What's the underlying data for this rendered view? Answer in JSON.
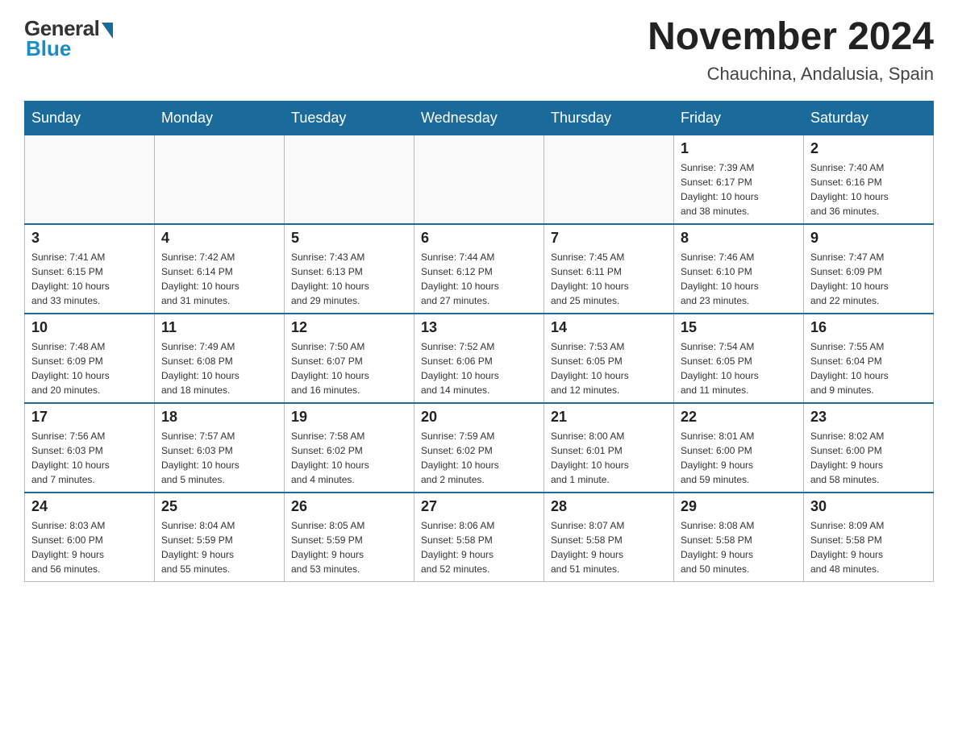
{
  "logo": {
    "general": "General",
    "blue": "Blue"
  },
  "header": {
    "month_year": "November 2024",
    "location": "Chauchina, Andalusia, Spain"
  },
  "days_of_week": [
    "Sunday",
    "Monday",
    "Tuesday",
    "Wednesday",
    "Thursday",
    "Friday",
    "Saturday"
  ],
  "weeks": [
    [
      {
        "day": "",
        "info": "",
        "empty": true
      },
      {
        "day": "",
        "info": "",
        "empty": true
      },
      {
        "day": "",
        "info": "",
        "empty": true
      },
      {
        "day": "",
        "info": "",
        "empty": true
      },
      {
        "day": "",
        "info": "",
        "empty": true
      },
      {
        "day": "1",
        "info": "Sunrise: 7:39 AM\nSunset: 6:17 PM\nDaylight: 10 hours\nand 38 minutes."
      },
      {
        "day": "2",
        "info": "Sunrise: 7:40 AM\nSunset: 6:16 PM\nDaylight: 10 hours\nand 36 minutes."
      }
    ],
    [
      {
        "day": "3",
        "info": "Sunrise: 7:41 AM\nSunset: 6:15 PM\nDaylight: 10 hours\nand 33 minutes."
      },
      {
        "day": "4",
        "info": "Sunrise: 7:42 AM\nSunset: 6:14 PM\nDaylight: 10 hours\nand 31 minutes."
      },
      {
        "day": "5",
        "info": "Sunrise: 7:43 AM\nSunset: 6:13 PM\nDaylight: 10 hours\nand 29 minutes."
      },
      {
        "day": "6",
        "info": "Sunrise: 7:44 AM\nSunset: 6:12 PM\nDaylight: 10 hours\nand 27 minutes."
      },
      {
        "day": "7",
        "info": "Sunrise: 7:45 AM\nSunset: 6:11 PM\nDaylight: 10 hours\nand 25 minutes."
      },
      {
        "day": "8",
        "info": "Sunrise: 7:46 AM\nSunset: 6:10 PM\nDaylight: 10 hours\nand 23 minutes."
      },
      {
        "day": "9",
        "info": "Sunrise: 7:47 AM\nSunset: 6:09 PM\nDaylight: 10 hours\nand 22 minutes."
      }
    ],
    [
      {
        "day": "10",
        "info": "Sunrise: 7:48 AM\nSunset: 6:09 PM\nDaylight: 10 hours\nand 20 minutes."
      },
      {
        "day": "11",
        "info": "Sunrise: 7:49 AM\nSunset: 6:08 PM\nDaylight: 10 hours\nand 18 minutes."
      },
      {
        "day": "12",
        "info": "Sunrise: 7:50 AM\nSunset: 6:07 PM\nDaylight: 10 hours\nand 16 minutes."
      },
      {
        "day": "13",
        "info": "Sunrise: 7:52 AM\nSunset: 6:06 PM\nDaylight: 10 hours\nand 14 minutes."
      },
      {
        "day": "14",
        "info": "Sunrise: 7:53 AM\nSunset: 6:05 PM\nDaylight: 10 hours\nand 12 minutes."
      },
      {
        "day": "15",
        "info": "Sunrise: 7:54 AM\nSunset: 6:05 PM\nDaylight: 10 hours\nand 11 minutes."
      },
      {
        "day": "16",
        "info": "Sunrise: 7:55 AM\nSunset: 6:04 PM\nDaylight: 10 hours\nand 9 minutes."
      }
    ],
    [
      {
        "day": "17",
        "info": "Sunrise: 7:56 AM\nSunset: 6:03 PM\nDaylight: 10 hours\nand 7 minutes."
      },
      {
        "day": "18",
        "info": "Sunrise: 7:57 AM\nSunset: 6:03 PM\nDaylight: 10 hours\nand 5 minutes."
      },
      {
        "day": "19",
        "info": "Sunrise: 7:58 AM\nSunset: 6:02 PM\nDaylight: 10 hours\nand 4 minutes."
      },
      {
        "day": "20",
        "info": "Sunrise: 7:59 AM\nSunset: 6:02 PM\nDaylight: 10 hours\nand 2 minutes."
      },
      {
        "day": "21",
        "info": "Sunrise: 8:00 AM\nSunset: 6:01 PM\nDaylight: 10 hours\nand 1 minute."
      },
      {
        "day": "22",
        "info": "Sunrise: 8:01 AM\nSunset: 6:00 PM\nDaylight: 9 hours\nand 59 minutes."
      },
      {
        "day": "23",
        "info": "Sunrise: 8:02 AM\nSunset: 6:00 PM\nDaylight: 9 hours\nand 58 minutes."
      }
    ],
    [
      {
        "day": "24",
        "info": "Sunrise: 8:03 AM\nSunset: 6:00 PM\nDaylight: 9 hours\nand 56 minutes."
      },
      {
        "day": "25",
        "info": "Sunrise: 8:04 AM\nSunset: 5:59 PM\nDaylight: 9 hours\nand 55 minutes."
      },
      {
        "day": "26",
        "info": "Sunrise: 8:05 AM\nSunset: 5:59 PM\nDaylight: 9 hours\nand 53 minutes."
      },
      {
        "day": "27",
        "info": "Sunrise: 8:06 AM\nSunset: 5:58 PM\nDaylight: 9 hours\nand 52 minutes."
      },
      {
        "day": "28",
        "info": "Sunrise: 8:07 AM\nSunset: 5:58 PM\nDaylight: 9 hours\nand 51 minutes."
      },
      {
        "day": "29",
        "info": "Sunrise: 8:08 AM\nSunset: 5:58 PM\nDaylight: 9 hours\nand 50 minutes."
      },
      {
        "day": "30",
        "info": "Sunrise: 8:09 AM\nSunset: 5:58 PM\nDaylight: 9 hours\nand 48 minutes."
      }
    ]
  ]
}
